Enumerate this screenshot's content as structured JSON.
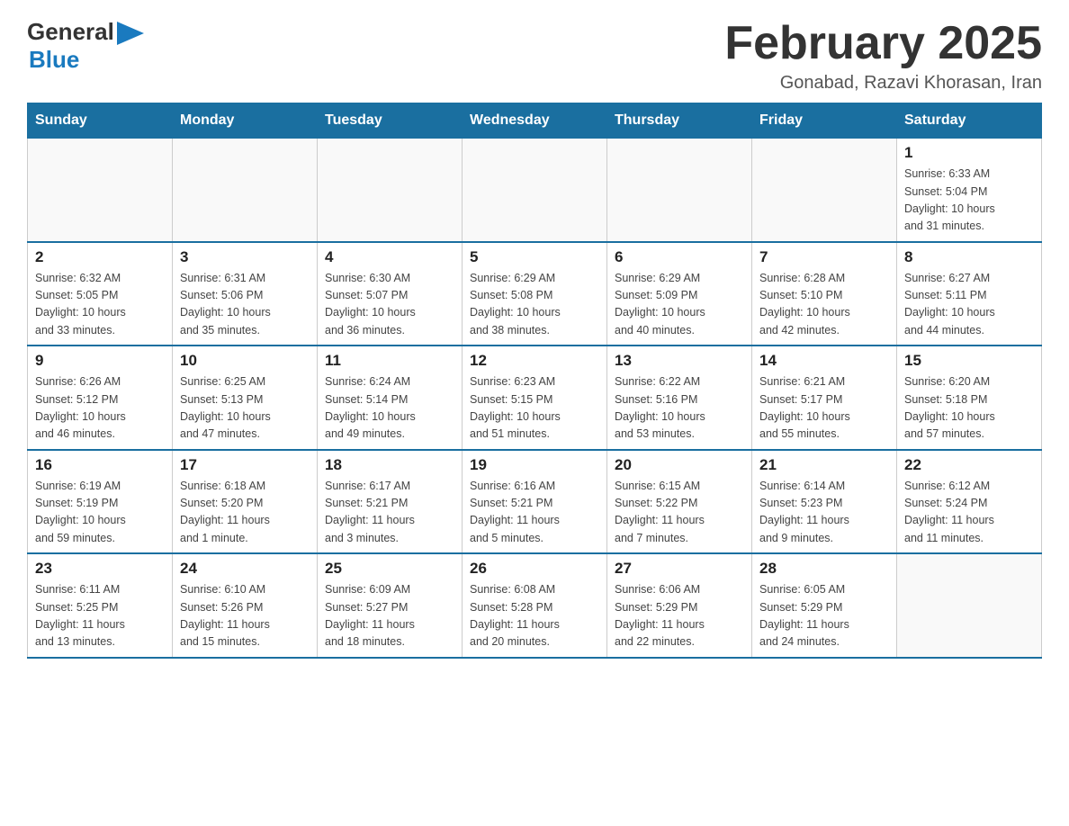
{
  "header": {
    "logo_general": "General",
    "logo_blue": "Blue",
    "title": "February 2025",
    "subtitle": "Gonabad, Razavi Khorasan, Iran"
  },
  "weekdays": [
    "Sunday",
    "Monday",
    "Tuesday",
    "Wednesday",
    "Thursday",
    "Friday",
    "Saturday"
  ],
  "weeks": [
    [
      {
        "day": "",
        "info": ""
      },
      {
        "day": "",
        "info": ""
      },
      {
        "day": "",
        "info": ""
      },
      {
        "day": "",
        "info": ""
      },
      {
        "day": "",
        "info": ""
      },
      {
        "day": "",
        "info": ""
      },
      {
        "day": "1",
        "info": "Sunrise: 6:33 AM\nSunset: 5:04 PM\nDaylight: 10 hours\nand 31 minutes."
      }
    ],
    [
      {
        "day": "2",
        "info": "Sunrise: 6:32 AM\nSunset: 5:05 PM\nDaylight: 10 hours\nand 33 minutes."
      },
      {
        "day": "3",
        "info": "Sunrise: 6:31 AM\nSunset: 5:06 PM\nDaylight: 10 hours\nand 35 minutes."
      },
      {
        "day": "4",
        "info": "Sunrise: 6:30 AM\nSunset: 5:07 PM\nDaylight: 10 hours\nand 36 minutes."
      },
      {
        "day": "5",
        "info": "Sunrise: 6:29 AM\nSunset: 5:08 PM\nDaylight: 10 hours\nand 38 minutes."
      },
      {
        "day": "6",
        "info": "Sunrise: 6:29 AM\nSunset: 5:09 PM\nDaylight: 10 hours\nand 40 minutes."
      },
      {
        "day": "7",
        "info": "Sunrise: 6:28 AM\nSunset: 5:10 PM\nDaylight: 10 hours\nand 42 minutes."
      },
      {
        "day": "8",
        "info": "Sunrise: 6:27 AM\nSunset: 5:11 PM\nDaylight: 10 hours\nand 44 minutes."
      }
    ],
    [
      {
        "day": "9",
        "info": "Sunrise: 6:26 AM\nSunset: 5:12 PM\nDaylight: 10 hours\nand 46 minutes."
      },
      {
        "day": "10",
        "info": "Sunrise: 6:25 AM\nSunset: 5:13 PM\nDaylight: 10 hours\nand 47 minutes."
      },
      {
        "day": "11",
        "info": "Sunrise: 6:24 AM\nSunset: 5:14 PM\nDaylight: 10 hours\nand 49 minutes."
      },
      {
        "day": "12",
        "info": "Sunrise: 6:23 AM\nSunset: 5:15 PM\nDaylight: 10 hours\nand 51 minutes."
      },
      {
        "day": "13",
        "info": "Sunrise: 6:22 AM\nSunset: 5:16 PM\nDaylight: 10 hours\nand 53 minutes."
      },
      {
        "day": "14",
        "info": "Sunrise: 6:21 AM\nSunset: 5:17 PM\nDaylight: 10 hours\nand 55 minutes."
      },
      {
        "day": "15",
        "info": "Sunrise: 6:20 AM\nSunset: 5:18 PM\nDaylight: 10 hours\nand 57 minutes."
      }
    ],
    [
      {
        "day": "16",
        "info": "Sunrise: 6:19 AM\nSunset: 5:19 PM\nDaylight: 10 hours\nand 59 minutes."
      },
      {
        "day": "17",
        "info": "Sunrise: 6:18 AM\nSunset: 5:20 PM\nDaylight: 11 hours\nand 1 minute."
      },
      {
        "day": "18",
        "info": "Sunrise: 6:17 AM\nSunset: 5:21 PM\nDaylight: 11 hours\nand 3 minutes."
      },
      {
        "day": "19",
        "info": "Sunrise: 6:16 AM\nSunset: 5:21 PM\nDaylight: 11 hours\nand 5 minutes."
      },
      {
        "day": "20",
        "info": "Sunrise: 6:15 AM\nSunset: 5:22 PM\nDaylight: 11 hours\nand 7 minutes."
      },
      {
        "day": "21",
        "info": "Sunrise: 6:14 AM\nSunset: 5:23 PM\nDaylight: 11 hours\nand 9 minutes."
      },
      {
        "day": "22",
        "info": "Sunrise: 6:12 AM\nSunset: 5:24 PM\nDaylight: 11 hours\nand 11 minutes."
      }
    ],
    [
      {
        "day": "23",
        "info": "Sunrise: 6:11 AM\nSunset: 5:25 PM\nDaylight: 11 hours\nand 13 minutes."
      },
      {
        "day": "24",
        "info": "Sunrise: 6:10 AM\nSunset: 5:26 PM\nDaylight: 11 hours\nand 15 minutes."
      },
      {
        "day": "25",
        "info": "Sunrise: 6:09 AM\nSunset: 5:27 PM\nDaylight: 11 hours\nand 18 minutes."
      },
      {
        "day": "26",
        "info": "Sunrise: 6:08 AM\nSunset: 5:28 PM\nDaylight: 11 hours\nand 20 minutes."
      },
      {
        "day": "27",
        "info": "Sunrise: 6:06 AM\nSunset: 5:29 PM\nDaylight: 11 hours\nand 22 minutes."
      },
      {
        "day": "28",
        "info": "Sunrise: 6:05 AM\nSunset: 5:29 PM\nDaylight: 11 hours\nand 24 minutes."
      },
      {
        "day": "",
        "info": ""
      }
    ]
  ]
}
